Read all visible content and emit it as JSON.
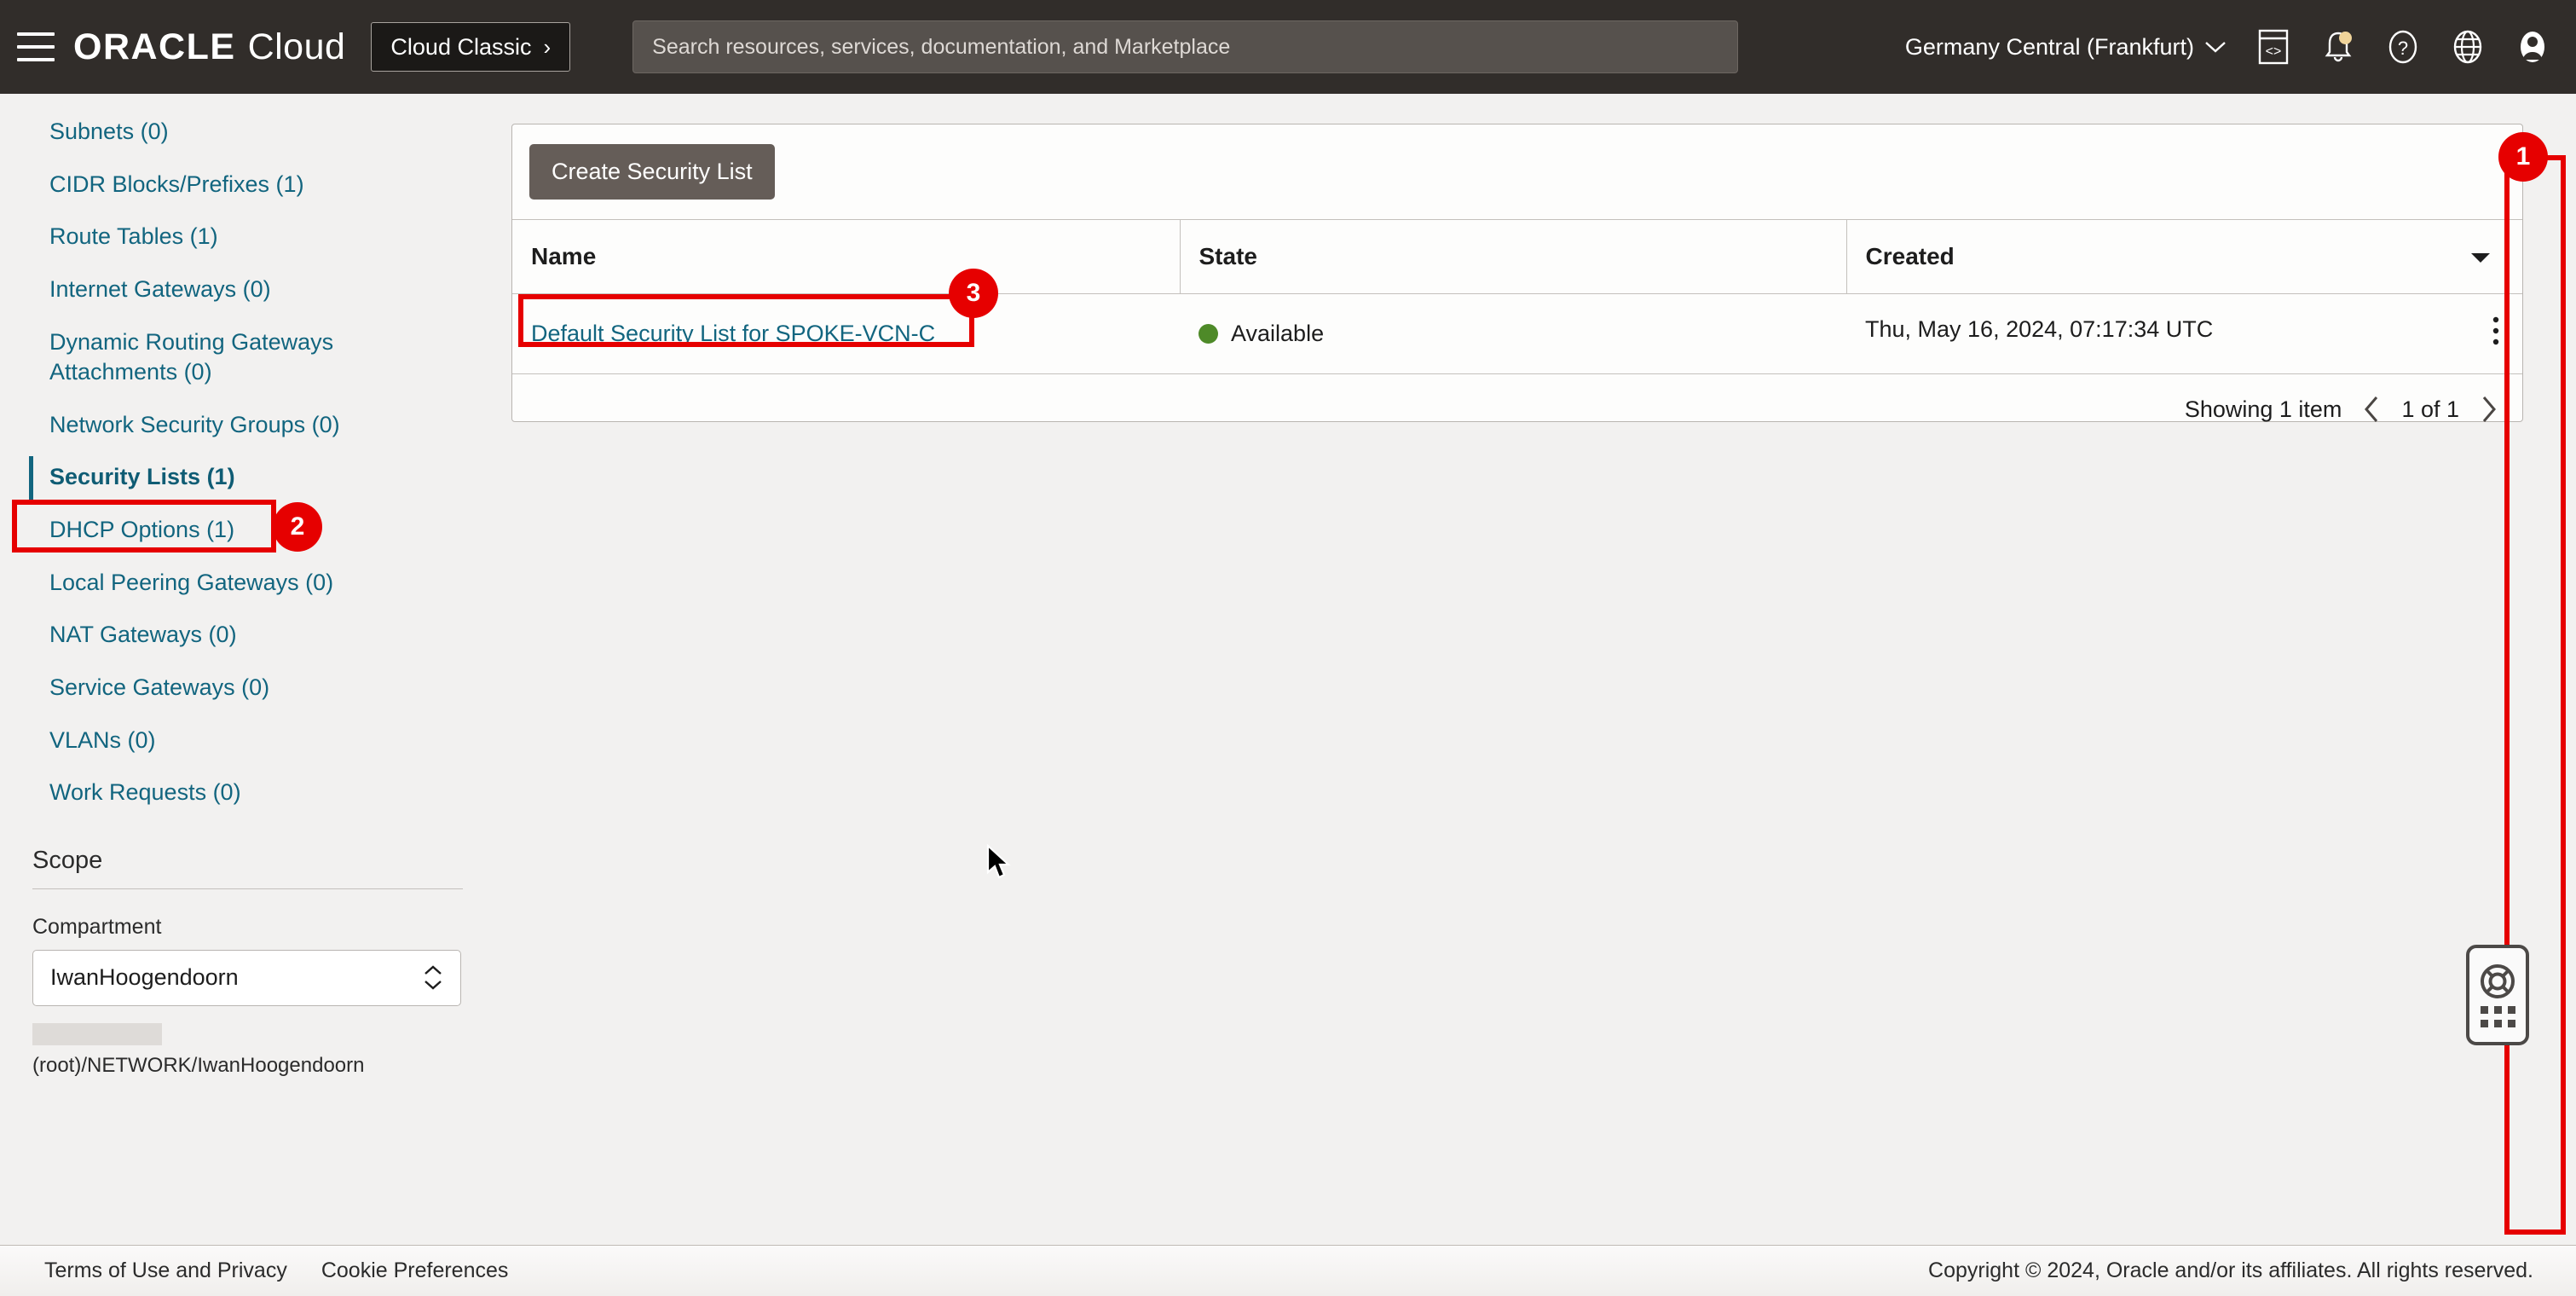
{
  "header": {
    "menu_icon": "hamburger-icon",
    "brand_oracle": "ORACLE",
    "brand_cloud": "Cloud",
    "classic_button": "Cloud Classic",
    "classic_chevron": "›",
    "search_placeholder": "Search resources, services, documentation, and Marketplace",
    "search_value": "",
    "region": "Germany Central (Frankfurt)",
    "region_chevron": "∨",
    "icons": [
      "cloud-shell-icon",
      "notifications-bell-icon",
      "help-question-icon",
      "language-globe-icon",
      "user-avatar-icon"
    ]
  },
  "sidebar": {
    "items": [
      {
        "label": "Subnets (0)",
        "active": false
      },
      {
        "label": "CIDR Blocks/Prefixes (1)",
        "active": false
      },
      {
        "label": "Route Tables (1)",
        "active": false
      },
      {
        "label": "Internet Gateways (0)",
        "active": false
      },
      {
        "label": "Dynamic Routing Gateways Attachments (0)",
        "active": false
      },
      {
        "label": "Network Security Groups (0)",
        "active": false
      },
      {
        "label": "Security Lists (1)",
        "active": true
      },
      {
        "label": "DHCP Options (1)",
        "active": false
      },
      {
        "label": "Local Peering Gateways (0)",
        "active": false
      },
      {
        "label": "NAT Gateways (0)",
        "active": false
      },
      {
        "label": "Service Gateways (0)",
        "active": false
      },
      {
        "label": "VLANs (0)",
        "active": false
      },
      {
        "label": "Work Requests (0)",
        "active": false
      }
    ],
    "scope": {
      "title": "Scope",
      "compartment_label": "Compartment",
      "compartment_value": "IwanHoogendoorn",
      "compartment_path": "(root)/NETWORK/IwanHoogendoorn"
    }
  },
  "main": {
    "create_button": "Create Security List",
    "table": {
      "columns": [
        "Name",
        "State",
        "Created"
      ],
      "sort_column": "Created",
      "rows": [
        {
          "name": "Default Security List for SPOKE-VCN-C",
          "state": "Available",
          "state_color": "#4e8a28",
          "created": "Thu, May 16, 2024, 07:17:34 UTC",
          "row_menu": "row-actions-icon"
        }
      ]
    },
    "pagination": {
      "showing": "Showing 1 item",
      "page_label": "1 of 1",
      "prev_icon": "chevron-left-icon",
      "next_icon": "chevron-right-icon"
    }
  },
  "annotations": {
    "accent_color": "#e60000",
    "badges": [
      {
        "number": "1",
        "target": "right-edge-region"
      },
      {
        "number": "2",
        "target": "sidebar-item-security-lists"
      },
      {
        "number": "3",
        "target": "security-list-name-link"
      }
    ]
  },
  "support_widget": {
    "icon": "life-ring-support-icon",
    "handle": "drag-handle-dots"
  },
  "footer": {
    "links": [
      "Terms of Use and Privacy",
      "Cookie Preferences"
    ],
    "copyright": "Copyright © 2024, Oracle and/or its affiliates. All rights reserved."
  }
}
